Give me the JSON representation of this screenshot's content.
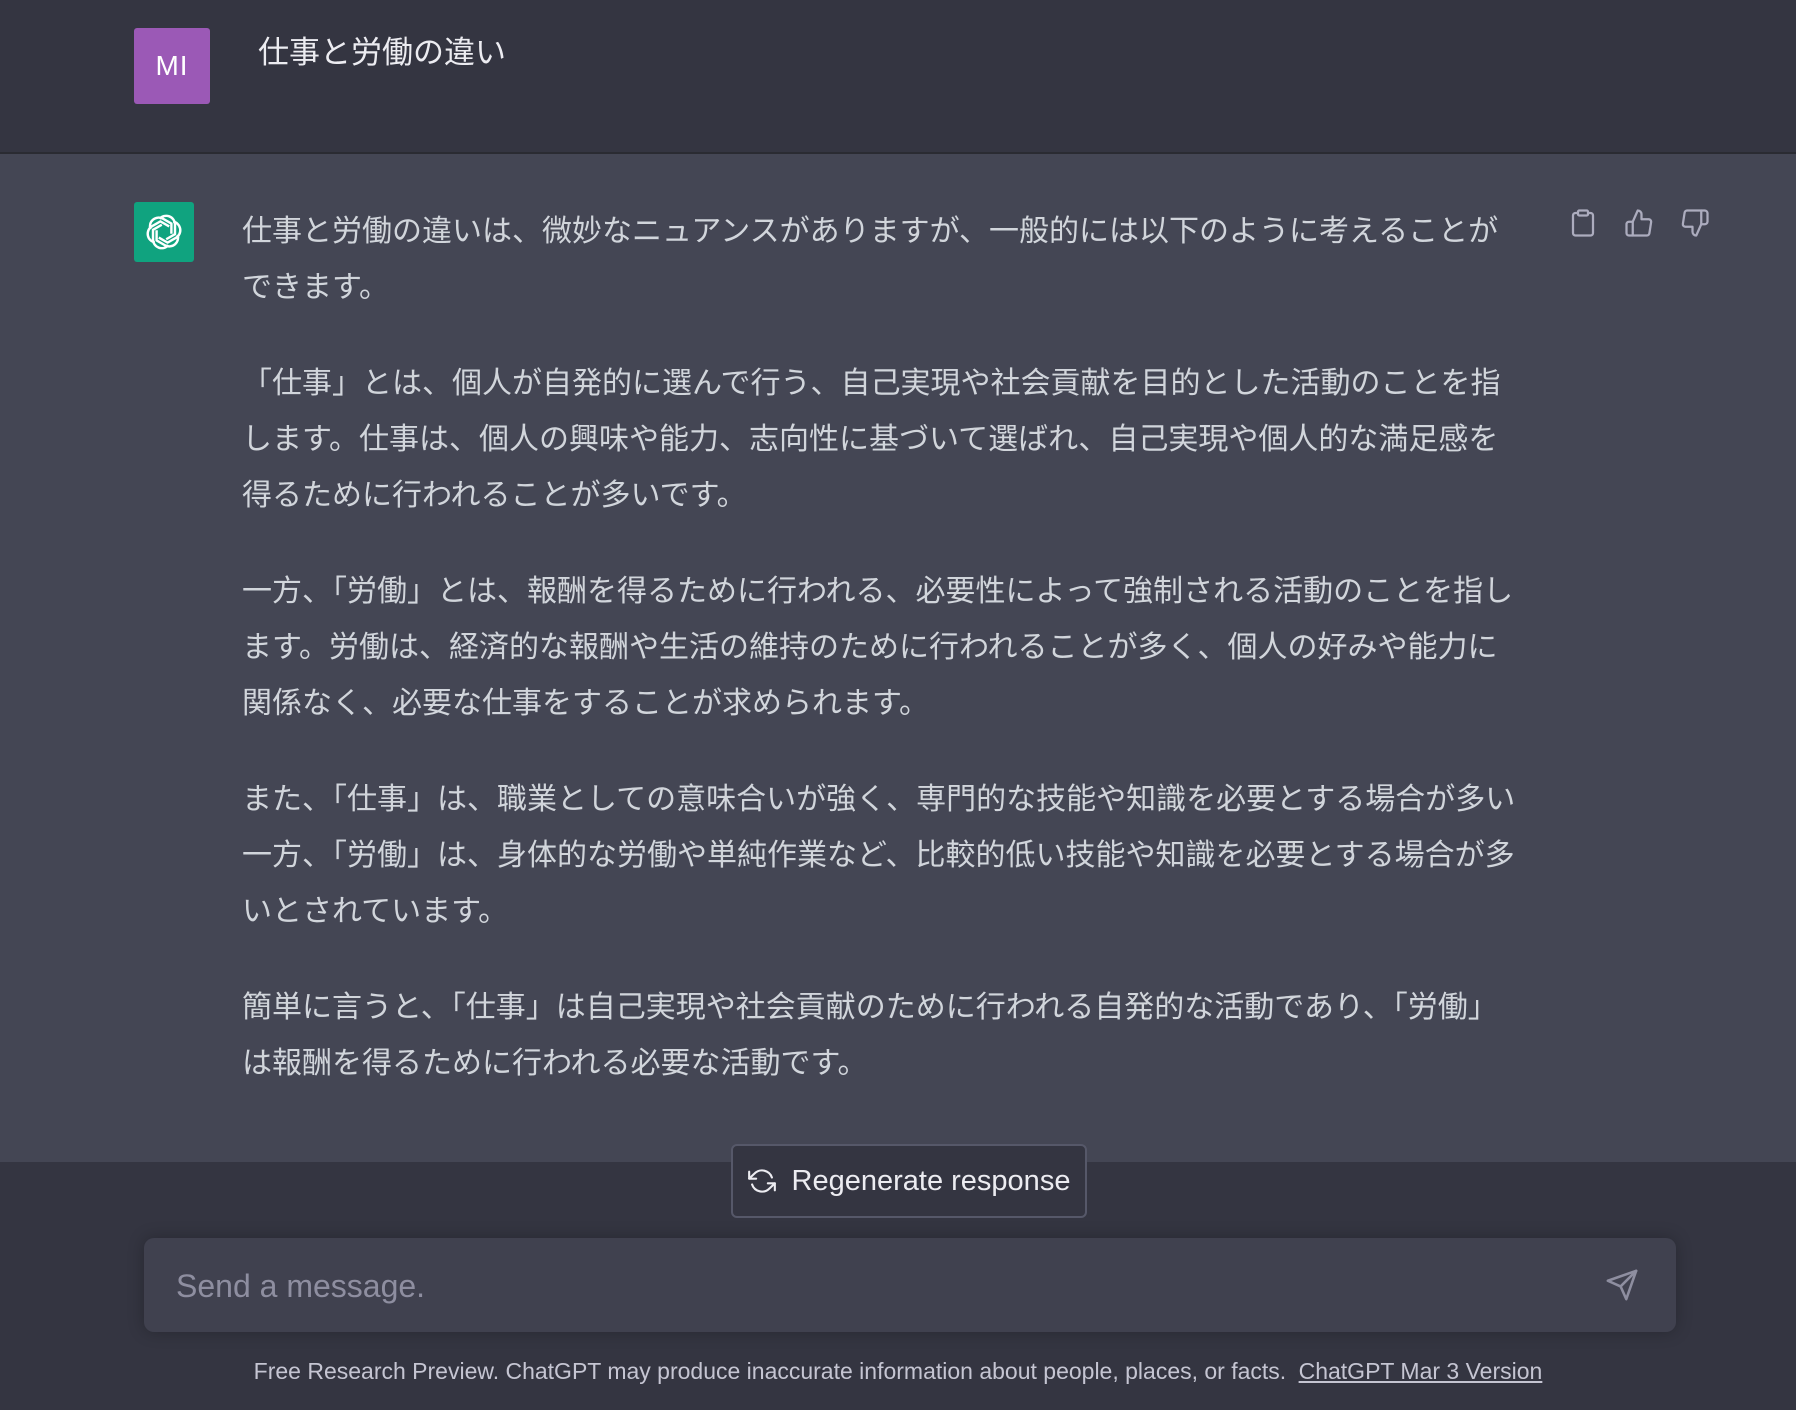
{
  "user_message": {
    "avatar_initials": "MI",
    "text": "仕事と労働の違い"
  },
  "assistant_message": {
    "paragraphs": [
      "仕事と労働の違いは、微妙なニュアンスがありますが、一般的には以下のように考えることができます。",
      "「仕事」とは、個人が自発的に選んで行う、自己実現や社会貢献を目的とした活動のことを指します。仕事は、個人の興味や能力、志向性に基づいて選ばれ、自己実現や個人的な満足感を得るために行われることが多いです。",
      "一方、「労働」とは、報酬を得るために行われる、必要性によって強制される活動のことを指します。労働は、経済的な報酬や生活の維持のために行われることが多く、個人の好みや能力に関係なく、必要な仕事をすることが求められます。",
      "また、「仕事」は、職業としての意味合いが強く、専門的な技能や知識を必要とする場合が多い一方、「労働」は、身体的な労働や単純作業など、比較的低い技能や知識を必要とする場合が多いとされています。",
      "簡単に言うと、「仕事」は自己実現や社会貢献のために行われる自発的な活動であり、「労働」は報酬を得るために行われる必要な活動です。"
    ],
    "actions": [
      "clipboard-icon",
      "thumbs-up-icon",
      "thumbs-down-icon"
    ]
  },
  "regenerate": {
    "label": "Regenerate response",
    "icon": "refresh-icon"
  },
  "composer": {
    "placeholder": "Send a message.",
    "send_icon": "send-icon"
  },
  "footer": {
    "text": "Free Research Preview. ChatGPT may produce inaccurate information about people, places, or facts.",
    "link_text": "ChatGPT Mar 3 Version"
  },
  "colors": {
    "background": "#343541",
    "assistant_background": "#444654",
    "user_avatar": "#9b59b6",
    "gpt_avatar": "#10a37f",
    "composer_background": "#40414f"
  }
}
